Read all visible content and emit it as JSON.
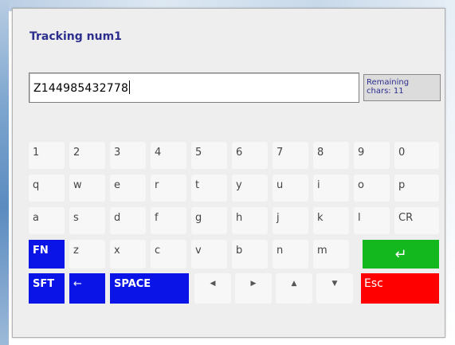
{
  "dialog": {
    "title": "Tracking num1",
    "input_value": "Z144985432778",
    "remaining": {
      "line1": "Remaining",
      "line2": "chars: 11"
    }
  },
  "keyboard": {
    "row1": [
      "1",
      "2",
      "3",
      "4",
      "5",
      "6",
      "7",
      "8",
      "9",
      "0"
    ],
    "row2": [
      "q",
      "w",
      "e",
      "r",
      "t",
      "y",
      "u",
      "i",
      "o",
      "p"
    ],
    "row3": [
      "a",
      "s",
      "d",
      "f",
      "g",
      "h",
      "j",
      "k",
      "l",
      "CR"
    ],
    "row4": {
      "fn": "FN",
      "letters": [
        "z",
        "x",
        "c",
        "v",
        "b",
        "n",
        "m"
      ],
      "enter_icon": "↵"
    },
    "row5": {
      "shift": "SFT",
      "backspace": "←",
      "space": "SPACE",
      "left_icon": "◀",
      "right_icon": "▶",
      "up_icon": "▲",
      "down_icon": "▼",
      "esc": "Esc"
    }
  },
  "colors": {
    "title": "#2d2f8f",
    "function_key": "#0a14e6",
    "enter_key": "#12b81e",
    "esc_key": "#ff0000",
    "dialog_bg": "#eeeeee"
  }
}
